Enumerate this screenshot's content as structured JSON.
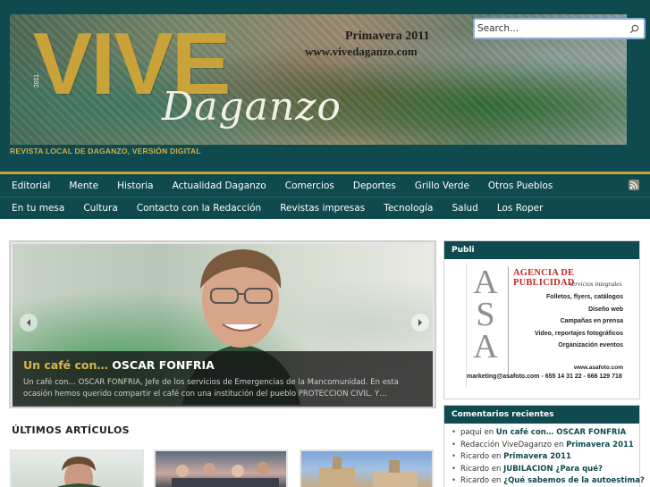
{
  "header": {
    "logo_main": "VIVE",
    "logo_script": "Daganzo",
    "issue": "Primavera 2011",
    "site_url": "www.vivedaganzo.com",
    "year_vertical": "2011",
    "tagline": "REVISTA LOCAL DE DAGANZO, VERSIÓN DIGITAL",
    "accent_color": "#c9a23a",
    "bg_color": "#0f4a4e"
  },
  "search": {
    "placeholder": "Search...",
    "icon": "search-icon"
  },
  "nav": {
    "row1": [
      "Editorial",
      "Mente",
      "Historia",
      "Actualidad Daganzo",
      "Comercios",
      "Deportes",
      "Grillo Verde",
      "Otros Pueblos"
    ],
    "row2": [
      "En tu mesa",
      "Cultura",
      "Contacto con la Redacción",
      "Revistas impresas",
      "Tecnología",
      "Salud",
      "Los Roper"
    ],
    "rss_icon": "rss-icon"
  },
  "slider": {
    "title_prefix": "Un café con…",
    "title_name": "OSCAR FONFRIA",
    "excerpt": "Un café con… OSCAR FONFRIA, Jefe de los servicios de Emergencias de la Mancomunidad. En esta ocasión hemos querido compartir el café con una institución del pueblo PROTECCION CIVIL. Y…",
    "prev_icon": "chevron-left-icon",
    "next_icon": "chevron-right-icon"
  },
  "latest": {
    "heading": "ÚLTIMOS ARTÍCULOS"
  },
  "sidebar": {
    "ad_widget_title": "Publi",
    "ad": {
      "letters": [
        "A",
        "S",
        "A"
      ],
      "agency": "AGENCIA DE PUBLICIDAD",
      "subtitle": "servicios integrales",
      "services": [
        "Folletos, flyers, catálogos",
        "Diseño web",
        "Campañas en prensa",
        "Video, reportajes fotográficos",
        "Organización eventos"
      ],
      "web": "www.asafoto.com",
      "contact": "marketing@asafoto.com - 655 14 31 22 - 666 129 718"
    },
    "comments_title": "Comentarios recientes",
    "comments": [
      {
        "author": "paqui",
        "sep": "en",
        "post": "Un café con… OSCAR FONFRIA"
      },
      {
        "author": "Redacción ViveDaganzo",
        "sep": "en",
        "post": "Primavera 2011"
      },
      {
        "author": "Ricardo",
        "sep": "en",
        "post": "Primavera 2011"
      },
      {
        "author": "Ricardo",
        "sep": "en",
        "post": "JUBILACION ¿Para qué?"
      },
      {
        "author": "Ricardo",
        "sep": "en",
        "post": "¿Qué sabemos de la autoestima?"
      }
    ]
  }
}
